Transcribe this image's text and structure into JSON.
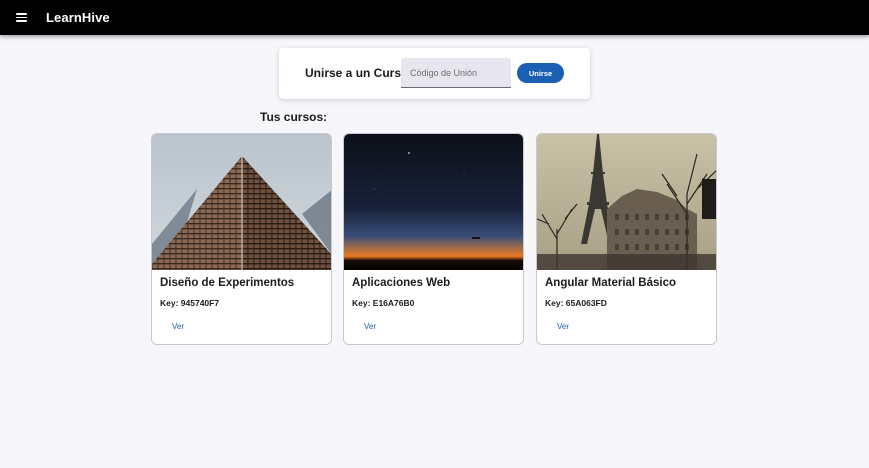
{
  "app": {
    "title": "LearnHive"
  },
  "join": {
    "label": "Unirse a un Curso:",
    "input_placeholder": "Código de Unión",
    "input_value": "",
    "button_label": "Unirse",
    "button_color": "#1a5fb4"
  },
  "courses_section": {
    "title": "Tus cursos:"
  },
  "courses": [
    {
      "name": "Diseño de Experimentos",
      "key": "Key: 945740F7",
      "action": "Ver",
      "image": "skyscraper-looking-up"
    },
    {
      "name": "Aplicaciones Web",
      "key": "Key: E16A76B0",
      "action": "Ver",
      "image": "night-horizon-sunset"
    },
    {
      "name": "Angular Material Básico",
      "key": "Key: 65A063FD",
      "action": "Ver",
      "image": "paris-eiffel-tower-street"
    }
  ]
}
